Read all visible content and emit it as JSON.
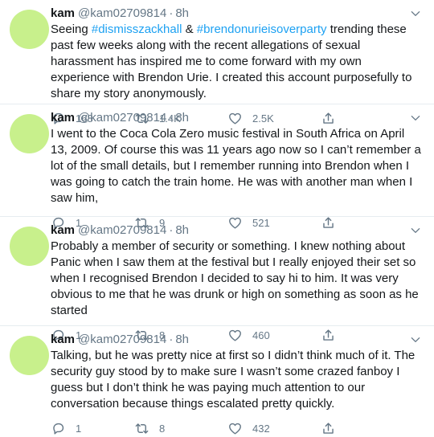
{
  "tweets": [
    {
      "name": "kam",
      "handle": "@kam02709814",
      "time": "8h",
      "parts": [
        {
          "t": "Seeing "
        },
        {
          "t": "#dismisszackhall",
          "tag": true
        },
        {
          "t": " & "
        },
        {
          "t": "#brendonurieisoverparty",
          "tag": true
        },
        {
          "t": " trending these past few weeks along with the recent allegations of sexual harassment has inspired me to come forward with my own experience with Brendon Urie.  I created this account purposefully to share my story anonymously."
        }
      ],
      "replies": "168",
      "retweets": "1.4K",
      "likes": "2.5K"
    },
    {
      "name": "kam",
      "handle": "@kam02709814",
      "time": "8h",
      "parts": [
        {
          "t": "I went to the Coca Cola Zero music festival in South Africa on April 13, 2009. Of course this was 11 years ago now so I can’t remember a lot of the small details, but I remember running into Brendon when I was going to catch the train home. He was with another man when I saw him,"
        }
      ],
      "replies": "1",
      "retweets": "9",
      "likes": "521"
    },
    {
      "name": "kam",
      "handle": "@kam02709814",
      "time": "8h",
      "parts": [
        {
          "t": "Probably a member of security or something. I knew nothing about Panic when I saw them at the festival but I really enjoyed their set so when I recognised Brendon I decided to say hi to him. It was very obvious to me that he was drunk or high on something as soon as he started"
        }
      ],
      "replies": "1",
      "retweets": "8",
      "likes": "460"
    },
    {
      "name": "kam",
      "handle": "@kam02709814",
      "time": "8h",
      "parts": [
        {
          "t": "Talking, but he was pretty nice at first so I didn’t think much of it. The security guy stood by to make sure I wasn’t some crazed fanboy I guess but I don’t think he was paying much attention to our conversation because things escalated pretty quickly."
        }
      ],
      "replies": "1",
      "retweets": "8",
      "likes": "432"
    }
  ],
  "icons": {
    "more": "chevron-down-icon",
    "reply": "reply-icon",
    "retweet": "retweet-icon",
    "like": "heart-icon",
    "share": "share-icon"
  },
  "colors": {
    "avatar": "#c8f08c",
    "hashtag": "#1da1f2",
    "secondary_text": "#657786",
    "divider": "#e6ecf0"
  }
}
